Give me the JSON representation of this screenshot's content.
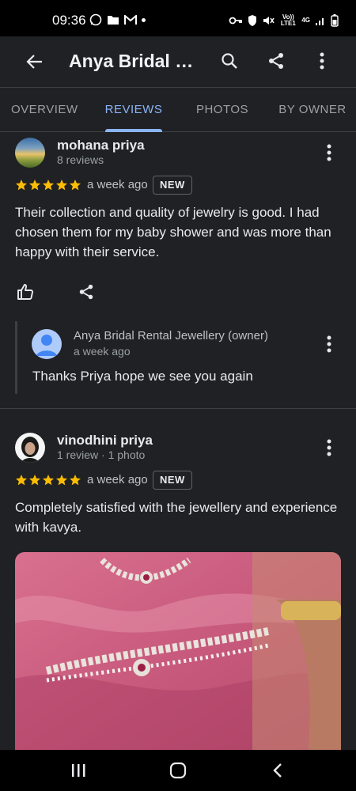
{
  "status_bar": {
    "time": "09:36",
    "network": "4G",
    "volte": "Vo)) LTE1"
  },
  "app_bar": {
    "title": "Anya Bridal Rental Jewellery"
  },
  "tabs": [
    {
      "label": "OVERVIEW",
      "active": false
    },
    {
      "label": "REVIEWS",
      "active": true
    },
    {
      "label": "PHOTOS",
      "active": false
    },
    {
      "label": "BY OWNER",
      "active": false
    }
  ],
  "reviews": [
    {
      "name": "mohana priya",
      "sub": "8 reviews",
      "rating": 5,
      "time": "a week ago",
      "badge": "NEW",
      "text": "Their collection and quality of jewelry is good. I had chosen them for my baby shower and was more than happy with their service.",
      "owner_reply": {
        "name": "Anya Bridal Rental Jewellery (owner)",
        "time": "a week ago",
        "text": "Thanks Priya hope we see you again"
      }
    },
    {
      "name": "vinodhini priya",
      "sub": "1 review · 1 photo",
      "rating": 5,
      "time": "a week ago",
      "badge": "NEW",
      "text": "Completely satisfied with the jewellery and experience with kavya."
    }
  ],
  "colors": {
    "accent": "#8ab4f8",
    "star": "#fbbc04",
    "background": "#202124"
  },
  "icons": [
    "back-arrow-icon",
    "search-icon",
    "share-icon",
    "more-vert-icon",
    "thumbs-up-icon",
    "person-icon"
  ]
}
